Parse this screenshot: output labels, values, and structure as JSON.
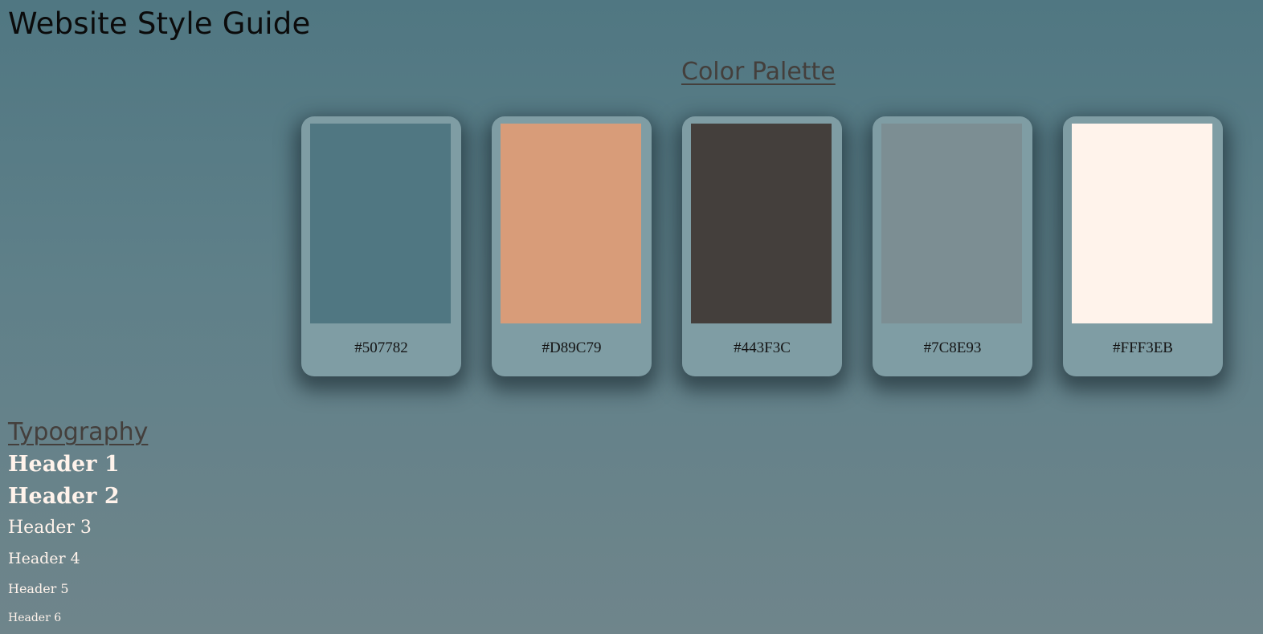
{
  "page": {
    "title": "Website Style Guide"
  },
  "palette": {
    "title": "Color Palette",
    "swatches": [
      {
        "hex": "#507782",
        "label": "#507782"
      },
      {
        "hex": "#D89C79",
        "label": "#D89C79"
      },
      {
        "hex": "#443F3C",
        "label": "#443F3C"
      },
      {
        "hex": "#7C8E93",
        "label": "#7C8E93"
      },
      {
        "hex": "#FFF3EB",
        "label": "#FFF3EB"
      }
    ]
  },
  "typography": {
    "title": "Typography",
    "samples": {
      "h1": "Header 1",
      "h2": "Header 2",
      "h3": "Header 3",
      "h4": "Header 4",
      "h5": "Header 5",
      "h6": "Header 6"
    }
  },
  "colors": {
    "background": "#507782",
    "card": "#7F9DA4",
    "heading_text": "#443F3C",
    "sample_text": "#FFF3EB"
  }
}
